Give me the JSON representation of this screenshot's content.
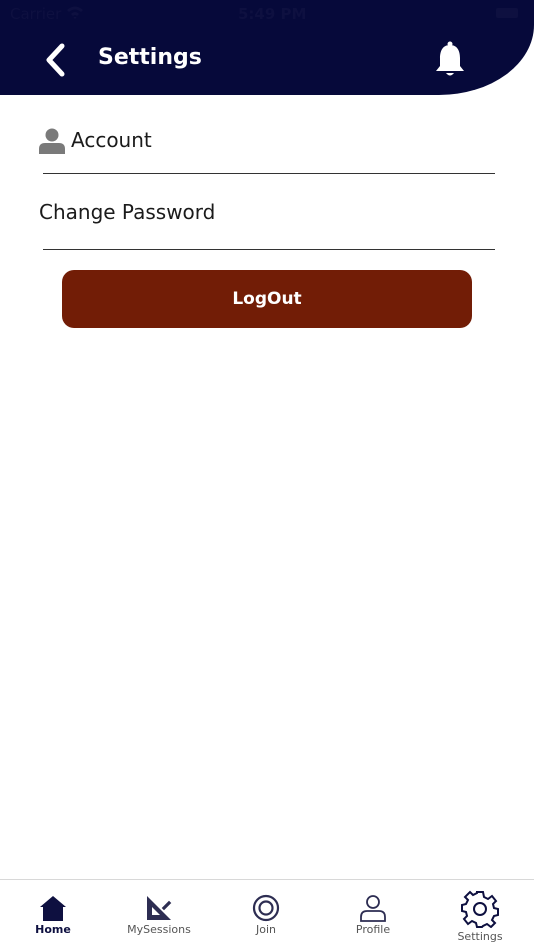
{
  "status_bar": {
    "carrier": "Carrier",
    "time": "5:49 PM"
  },
  "header": {
    "title": "Settings",
    "back_icon": "chevron-left-icon",
    "notification_icon": "bell-icon",
    "background_color": "#06093a"
  },
  "settings_list": {
    "items": [
      {
        "label": "Account",
        "icon": "person-icon"
      },
      {
        "label": "Change Password"
      }
    ]
  },
  "logout": {
    "label": "LogOut",
    "color": "#721d06"
  },
  "tab_bar": {
    "active": "Home",
    "tabs": [
      {
        "label": "Home",
        "icon": "home-icon"
      },
      {
        "label": "MySessions",
        "icon": "set-square-icon"
      },
      {
        "label": "Join",
        "icon": "circle-icon"
      },
      {
        "label": "Profile",
        "icon": "person-outline-icon"
      },
      {
        "label": "Settings",
        "icon": "gear-icon"
      }
    ]
  }
}
